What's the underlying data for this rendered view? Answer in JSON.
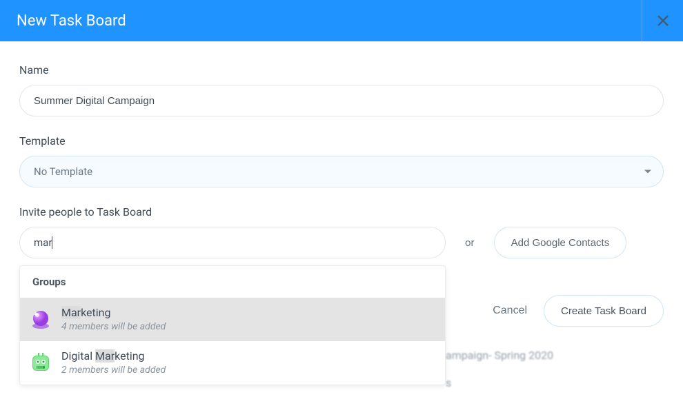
{
  "modal": {
    "title": "New Task Board",
    "nameLabel": "Name",
    "nameValue": "Summer Digital Campaign",
    "templateLabel": "Template",
    "templateValue": "No Template",
    "inviteLabel": "Invite people to Task Board",
    "inviteValue": "mar",
    "orText": "or",
    "googleContactsLabel": "Add Google Contacts",
    "cancelLabel": "Cancel",
    "createLabel": "Create Task Board"
  },
  "dropdown": {
    "header": "Groups",
    "items": [
      {
        "name": "Marketing",
        "highlight": "Mar",
        "rest": "keting",
        "subtext": "4 members will be added",
        "avatarColor1": "#9b3be4",
        "avatarColor2": "#e84dd4"
      },
      {
        "name": "Digital Marketing",
        "prefix": "Digital ",
        "highlight": "Mar",
        "rest": "keting",
        "subtext": "2 members will be added",
        "avatarColor1": "#5ad66a",
        "avatarColor2": "#2fa53f"
      }
    ]
  },
  "background": {
    "text1": "ampaign- Spring 2020",
    "text2": "s"
  }
}
